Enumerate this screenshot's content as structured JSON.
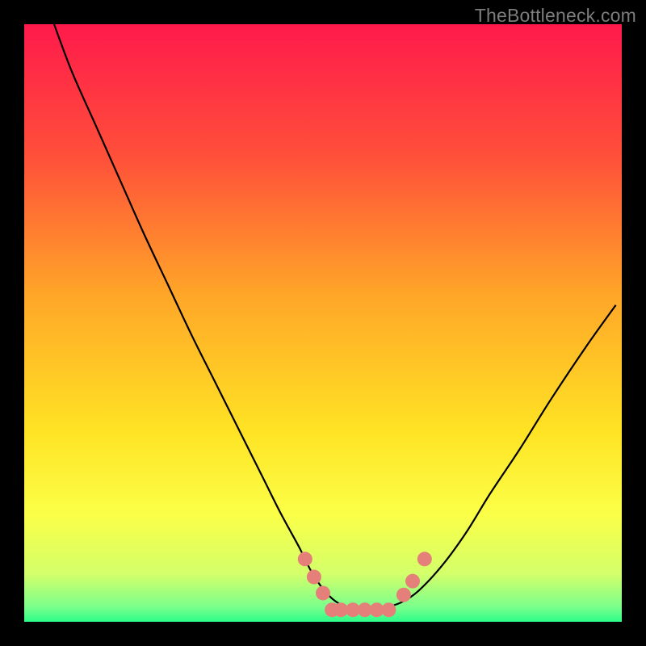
{
  "watermark": "TheBottleneck.com",
  "chart_data": {
    "type": "line",
    "title": "",
    "xlabel": "",
    "ylabel": "",
    "xlim": [
      0,
      100
    ],
    "ylim": [
      0,
      100
    ],
    "background_gradient": {
      "stops": [
        {
          "offset": 0.0,
          "color": "#ff1a4b"
        },
        {
          "offset": 0.22,
          "color": "#ff4f3a"
        },
        {
          "offset": 0.45,
          "color": "#ffa528"
        },
        {
          "offset": 0.68,
          "color": "#ffe324"
        },
        {
          "offset": 0.82,
          "color": "#fbff47"
        },
        {
          "offset": 0.92,
          "color": "#d3ff6a"
        },
        {
          "offset": 0.975,
          "color": "#7bff8c"
        },
        {
          "offset": 1.0,
          "color": "#2dfd8a"
        }
      ]
    },
    "series": [
      {
        "name": "bottleneck-curve",
        "color": "#000000",
        "width": 2.2,
        "x": [
          5,
          8,
          12,
          16,
          20,
          24,
          28,
          32,
          36,
          40,
          43,
          46,
          48,
          50,
          52,
          54,
          57,
          60,
          63,
          66,
          70,
          74,
          78,
          83,
          88,
          94,
          99
        ],
        "y": [
          100,
          92,
          83,
          74,
          65,
          56.5,
          48,
          40,
          32,
          24,
          18,
          12.5,
          8.5,
          5.5,
          3.5,
          2.5,
          2,
          2.3,
          3.2,
          5.2,
          9.5,
          15,
          21.5,
          29,
          37,
          46,
          53
        ]
      }
    ],
    "markers": {
      "name": "highlight-dots",
      "color": "#e48079",
      "radius": 9,
      "points": [
        {
          "x": 47,
          "y": 10.5
        },
        {
          "x": 48.5,
          "y": 7.5
        },
        {
          "x": 50,
          "y": 4.8
        },
        {
          "x": 51.5,
          "y": 2
        },
        {
          "x": 53,
          "y": 2
        },
        {
          "x": 55,
          "y": 2
        },
        {
          "x": 57,
          "y": 2
        },
        {
          "x": 59,
          "y": 2
        },
        {
          "x": 61,
          "y": 2
        },
        {
          "x": 63.5,
          "y": 4.5
        },
        {
          "x": 65,
          "y": 6.8
        },
        {
          "x": 67,
          "y": 10.5
        }
      ]
    }
  }
}
